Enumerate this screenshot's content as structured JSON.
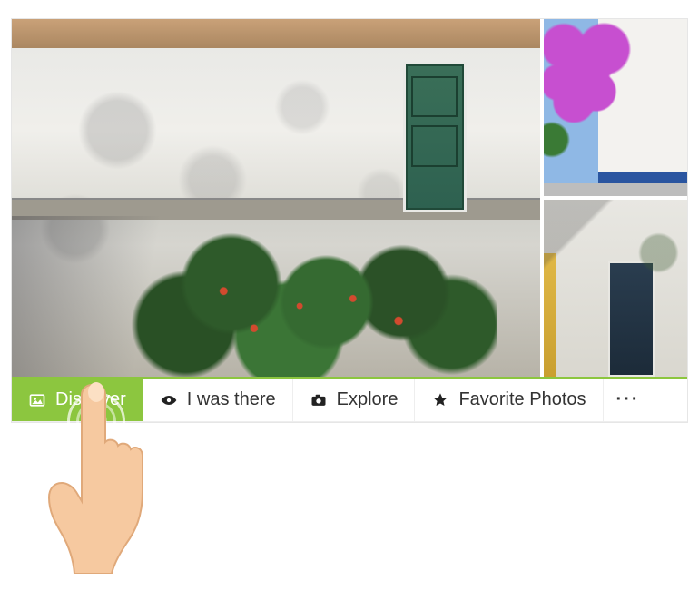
{
  "tabs": [
    {
      "label": "Discover",
      "icon": "image-icon",
      "active": true
    },
    {
      "label": "I was there",
      "icon": "eye-icon",
      "active": false
    },
    {
      "label": "Explore",
      "icon": "camera-icon",
      "active": false
    },
    {
      "label": "Favorite Photos",
      "icon": "star-icon",
      "active": false
    }
  ],
  "overflow_label": "···",
  "colors": {
    "accent": "#8cc63f"
  }
}
